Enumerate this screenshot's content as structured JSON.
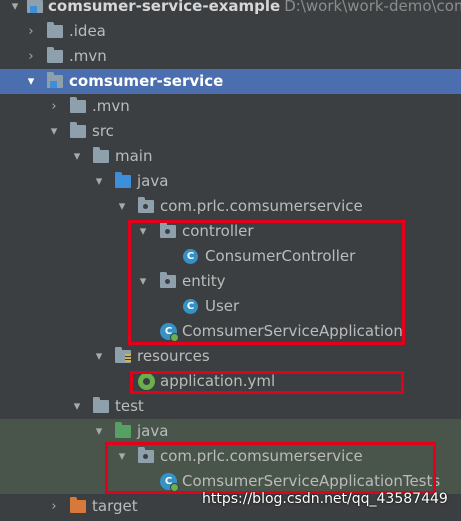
{
  "root": {
    "name": "comsumer-service-example",
    "path": "D:\\work\\work-demo\\comsu"
  },
  "tree": {
    "idea": ".idea",
    "mvn_root": ".mvn",
    "module": "comsumer-service",
    "mvn_module": ".mvn",
    "src": "src",
    "main": "main",
    "java_main": "java",
    "package_main": "com.prlc.comsumerservice",
    "controller": "controller",
    "consumer_controller": "ConsumerController",
    "entity": "entity",
    "user": "User",
    "app_class": "ComsumerServiceApplication",
    "resources": "resources",
    "application_yml": "application.yml",
    "test": "test",
    "java_test": "java",
    "package_test": "com.prlc.comsumerservice",
    "app_tests": "ComsumerServiceApplicationTests",
    "target": "target"
  },
  "icons": {
    "arrow_expanded": "▾",
    "arrow_collapsed": "›",
    "class_letter": "C"
  },
  "watermark": "https://blog.csdn.net/qq_43587449",
  "colors": {
    "background": "#3c3f41",
    "selection": "#4b6eaf",
    "test_background": "#49544a",
    "highlight_box": "#e3001b"
  }
}
